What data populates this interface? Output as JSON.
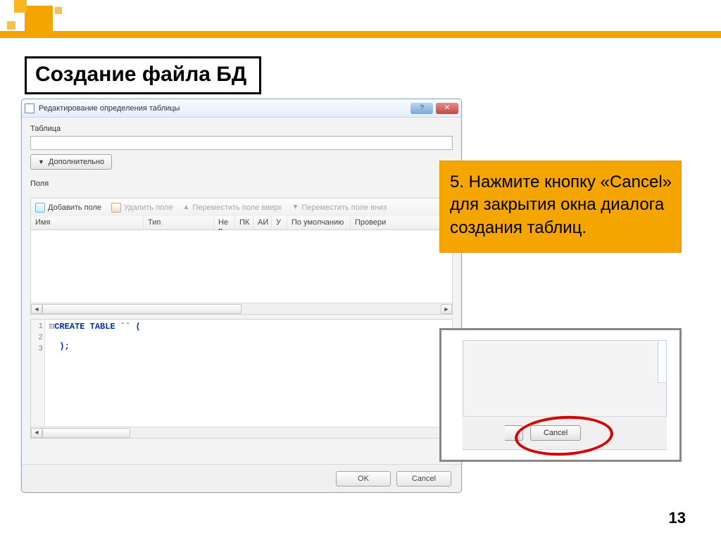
{
  "slide": {
    "title": "Создание файла БД",
    "page_number": "13"
  },
  "dialog": {
    "title": "Редактирование определения таблицы",
    "table_label": "Таблица",
    "table_value": "",
    "advanced_button": "Дополнительно",
    "fields_label": "Поля",
    "toolbar": {
      "add": "Добавить поле",
      "delete": "Удалить поле",
      "move_up": "Переместить поле вверх",
      "move_down": "Переместить поле вниз"
    },
    "columns": {
      "name": "Имя",
      "type": "Тип",
      "notnull": "Не п",
      "pk": "ПК",
      "ai": "АИ",
      "u": "У",
      "default": "По умолчанию",
      "check": "Провери"
    },
    "sql": {
      "line1": "CREATE TABLE `` (",
      "line2": "",
      "line3": ");"
    },
    "buttons": {
      "ok": "OK",
      "cancel": "Cancel"
    }
  },
  "callout": {
    "text": "5. Нажмите кнопку «Cancel» для закрытия окна диалога создания таблиц."
  },
  "zoom": {
    "cancel": "Cancel"
  }
}
